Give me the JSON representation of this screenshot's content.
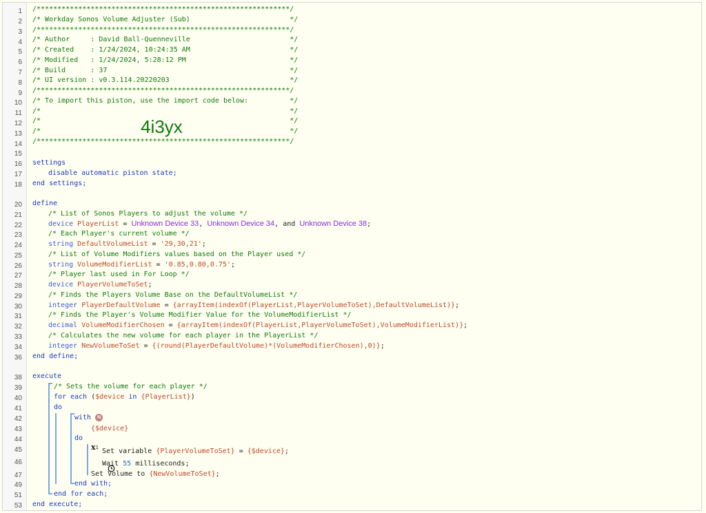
{
  "header": [
    "/*************************************************************/",
    "/* Workday Sonos Volume Adjuster (Sub)                        */",
    "/*************************************************************/",
    "/* Author     : David Ball-Quenneville                        */",
    "/* Created    : 1/24/2024, 10:24:35 AM                        */",
    "/* Modified   : 1/24/2024, 5:28:12 PM                         */",
    "/* Build      : 37                                            */",
    "/* UI version : v0.3.114.20220203                             */",
    "/*************************************************************/",
    "/* To import this piston, use the import code below:          */",
    "/*                                                            */",
    "/*                                                            */",
    "/*                                                            */",
    "/*************************************************************/"
  ],
  "import_code": "4i3yx",
  "settings": {
    "open": "settings",
    "body": "disable automatic piston state;",
    "close": "end settings;"
  },
  "define": {
    "open": "define",
    "c1": "/* List of Sonos Players to adjust the volume */",
    "playerlist_type": "device",
    "playerlist_name": "PlayerList",
    "dev1": "Unknown Device 33",
    "dev2": "Unknown Device 34",
    "dev3": "Unknown Device 38",
    "and": "and",
    "c2": "/* Each Player's current volume */",
    "dvl_type": "string",
    "dvl_name": "DefaultVolumeList",
    "dvl_value": "'29,30,21'",
    "c3": "/* List of Volume Modifiers values based on the Player used */",
    "vml_type": "string",
    "vml_name": "VolumeModifierList",
    "vml_value": "'0.85,0.80,0.75'",
    "c4": "/* Player last used in For Loop */",
    "pvs_type": "device",
    "pvs_name": "PlayerVolumeToSet",
    "c5": "/* Finds the Players Volume Base on the DefaultVolumeList */",
    "pdv_type": "integer",
    "pdv_name": "PlayerDefaultVolume",
    "pdv_expr": "{arrayItem(indexOf(PlayerList,PlayerVolumeToSet),DefaultVolumeList)}",
    "c6": "/* Finds the Player's Volume Modifier Value for the VolumeModifierList */",
    "vmc_type": "decimal",
    "vmc_name": "VolumeModifierChosen",
    "vmc_expr": "{arrayItem(indexOf(PlayerList,PlayerVolumeToSet),VolumeModifierList)}",
    "c7": "/* Calculates the new volume for each player in the PlayerList */",
    "nvs_type": "integer",
    "nvs_name": "NewVolumeToSet",
    "nvs_expr": "{(round(PlayerDefaultVolume)*(VolumeModifierChosen),0)}",
    "close": "end define;"
  },
  "execute": {
    "open": "execute",
    "c1": "/* Sets the volume for each player */",
    "for_each": "for each",
    "device_var": "$device",
    "in": "in",
    "list_ref": "{PlayerList}",
    "do": "do",
    "with": "with",
    "with_target": "{$device}",
    "do2": "do",
    "set_variable": "Set variable",
    "set_target": "{PlayerVolumeToSet}",
    "set_value": "{$device}",
    "wait": "Wait",
    "wait_value": "55",
    "wait_unit": "milliseconds;",
    "set_volume": "Set Volume to",
    "volume_value": "{NewVolumeToSet}",
    "end_with": "end with;",
    "end_for": "end for each;",
    "close": "end execute;"
  },
  "line_numbers": [
    "1",
    "2",
    "3",
    "4",
    "5",
    "6",
    "7",
    "8",
    "9",
    "10",
    "11",
    "12",
    "13",
    "14",
    "15",
    "16",
    "17",
    "18",
    "20",
    "21",
    "22",
    "23",
    "24",
    "25",
    "26",
    "27",
    "28",
    "29",
    "30",
    "31",
    "32",
    "33",
    "34",
    "36",
    "38",
    "39",
    "40",
    "41",
    "42",
    "43",
    "44",
    "45",
    "46",
    "47",
    "49",
    "51",
    "53"
  ]
}
